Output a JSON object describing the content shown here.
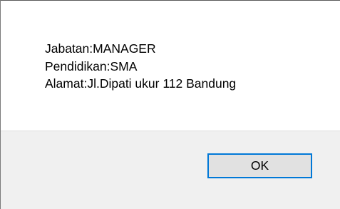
{
  "dialog": {
    "message_lines": [
      "Jabatan:MANAGER",
      "Pendidikan:SMA",
      "Alamat:Jl.Dipati ukur 112 Bandung"
    ],
    "ok_label": "OK"
  },
  "colors": {
    "button_focus_border": "#0078d7",
    "button_face": "#e1e1e1",
    "footer_background": "#f0f0f0"
  }
}
